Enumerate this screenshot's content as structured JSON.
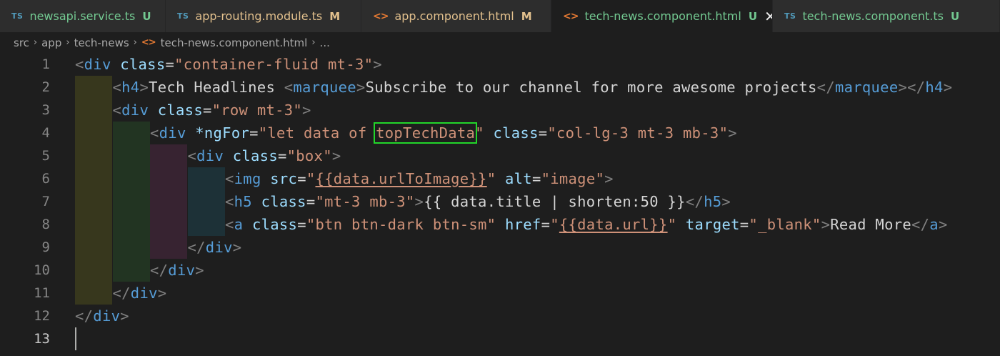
{
  "tabs": [
    {
      "icon": "TS",
      "icon_type": "ts",
      "name": "newsapi.service.ts",
      "status": "U",
      "name_color": "#73c991",
      "status_color": "#73c991",
      "active": false
    },
    {
      "icon": "TS",
      "icon_type": "ts",
      "name": "app-routing.module.ts",
      "status": "M",
      "name_color": "#e2c08d",
      "status_color": "#e2c08d",
      "active": false
    },
    {
      "icon": "<>",
      "icon_type": "html",
      "name": "app.component.html",
      "status": "M",
      "name_color": "#e2c08d",
      "status_color": "#e2c08d",
      "active": false
    },
    {
      "icon": "<>",
      "icon_type": "html",
      "name": "tech-news.component.html",
      "status": "U",
      "name_color": "#73c991",
      "status_color": "#73c991",
      "active": true,
      "close": "✕"
    },
    {
      "icon": "TS",
      "icon_type": "ts",
      "name": "tech-news.component.ts",
      "status": "U",
      "name_color": "#73c991",
      "status_color": "#73c991",
      "active": false
    }
  ],
  "breadcrumb": {
    "parts": [
      "src",
      "app",
      "tech-news"
    ],
    "file_icon": "<>",
    "file": "tech-news.component.html",
    "ellipsis": "..."
  },
  "editor": {
    "current_line": 13,
    "highlight_color": "#22d62a",
    "lines": [
      {
        "num": "1",
        "indent": 0,
        "tokens": [
          [
            "br",
            "<"
          ],
          [
            "tag",
            "div"
          ],
          [
            "txt",
            " "
          ],
          [
            "attr",
            "class"
          ],
          [
            "txt",
            "="
          ],
          [
            "str",
            "\"container-fluid mt-3\""
          ],
          [
            "br",
            ">"
          ]
        ]
      },
      {
        "num": "2",
        "indent": 1,
        "tokens": [
          [
            "br",
            "<"
          ],
          [
            "tag",
            "h4"
          ],
          [
            "br",
            ">"
          ],
          [
            "txt",
            "Tech Headlines "
          ],
          [
            "br",
            "<"
          ],
          [
            "tag",
            "marquee"
          ],
          [
            "br",
            ">"
          ],
          [
            "txt",
            "Subscribe to our channel for more awesome projects"
          ],
          [
            "br",
            "</"
          ],
          [
            "tag",
            "marquee"
          ],
          [
            "br",
            "></"
          ],
          [
            "tag",
            "h4"
          ],
          [
            "br",
            ">"
          ]
        ]
      },
      {
        "num": "3",
        "indent": 1,
        "tokens": [
          [
            "br",
            "<"
          ],
          [
            "tag",
            "div"
          ],
          [
            "txt",
            " "
          ],
          [
            "attr",
            "class"
          ],
          [
            "txt",
            "="
          ],
          [
            "str",
            "\"row mt-3\""
          ],
          [
            "br",
            ">"
          ]
        ]
      },
      {
        "num": "4",
        "indent": 2,
        "tokens": [
          [
            "br",
            "<"
          ],
          [
            "tag",
            "div"
          ],
          [
            "txt",
            " "
          ],
          [
            "attr",
            "*ngFor"
          ],
          [
            "txt",
            "="
          ],
          [
            "str",
            "\"let data of "
          ],
          [
            "hl",
            "topTechData"
          ],
          [
            "str",
            "\""
          ],
          [
            "txt",
            " "
          ],
          [
            "attr",
            "class"
          ],
          [
            "txt",
            "="
          ],
          [
            "str",
            "\"col-lg-3 mt-3 mb-3\""
          ],
          [
            "br",
            ">"
          ]
        ]
      },
      {
        "num": "5",
        "indent": 3,
        "tokens": [
          [
            "br",
            "<"
          ],
          [
            "tag",
            "div"
          ],
          [
            "txt",
            " "
          ],
          [
            "attr",
            "class"
          ],
          [
            "txt",
            "="
          ],
          [
            "str",
            "\"box\""
          ],
          [
            "br",
            ">"
          ]
        ]
      },
      {
        "num": "6",
        "indent": 4,
        "tokens": [
          [
            "br",
            "<"
          ],
          [
            "tag",
            "img"
          ],
          [
            "txt",
            " "
          ],
          [
            "attr",
            "src"
          ],
          [
            "txt",
            "="
          ],
          [
            "str",
            "\""
          ],
          [
            "interp",
            "{{data.urlToImage}}"
          ],
          [
            "str",
            "\""
          ],
          [
            "txt",
            " "
          ],
          [
            "attr",
            "alt"
          ],
          [
            "txt",
            "="
          ],
          [
            "str",
            "\"image\""
          ],
          [
            "br",
            ">"
          ]
        ]
      },
      {
        "num": "7",
        "indent": 4,
        "tokens": [
          [
            "br",
            "<"
          ],
          [
            "tag",
            "h5"
          ],
          [
            "txt",
            " "
          ],
          [
            "attr",
            "class"
          ],
          [
            "txt",
            "="
          ],
          [
            "str",
            "\"mt-3 mb-3\""
          ],
          [
            "br",
            ">"
          ],
          [
            "txt",
            "{{ data.title | shorten:50 }}"
          ],
          [
            "br",
            "</"
          ],
          [
            "tag",
            "h5"
          ],
          [
            "br",
            ">"
          ]
        ]
      },
      {
        "num": "8",
        "indent": 4,
        "tokens": [
          [
            "br",
            "<"
          ],
          [
            "tag",
            "a"
          ],
          [
            "txt",
            " "
          ],
          [
            "attr",
            "class"
          ],
          [
            "txt",
            "="
          ],
          [
            "str",
            "\"btn btn-dark btn-sm\""
          ],
          [
            "txt",
            " "
          ],
          [
            "attr",
            "href"
          ],
          [
            "txt",
            "="
          ],
          [
            "str",
            "\""
          ],
          [
            "interp",
            "{{data.url}}"
          ],
          [
            "str",
            "\""
          ],
          [
            "txt",
            " "
          ],
          [
            "attr",
            "target"
          ],
          [
            "txt",
            "="
          ],
          [
            "str",
            "\"_blank\""
          ],
          [
            "br",
            ">"
          ],
          [
            "txt",
            "Read More"
          ],
          [
            "br",
            "</"
          ],
          [
            "tag",
            "a"
          ],
          [
            "br",
            ">"
          ]
        ]
      },
      {
        "num": "9",
        "indent": 3,
        "tokens": [
          [
            "br",
            "</"
          ],
          [
            "tag",
            "div"
          ],
          [
            "br",
            ">"
          ]
        ]
      },
      {
        "num": "10",
        "indent": 2,
        "tokens": [
          [
            "br",
            "</"
          ],
          [
            "tag",
            "div"
          ],
          [
            "br",
            ">"
          ]
        ]
      },
      {
        "num": "11",
        "indent": 1,
        "tokens": [
          [
            "br",
            "</"
          ],
          [
            "tag",
            "div"
          ],
          [
            "br",
            ">"
          ]
        ]
      },
      {
        "num": "12",
        "indent": 0,
        "tokens": [
          [
            "br",
            "</"
          ],
          [
            "tag",
            "div"
          ],
          [
            "br",
            ">"
          ]
        ]
      },
      {
        "num": "13",
        "indent": 0,
        "tokens": []
      }
    ]
  }
}
